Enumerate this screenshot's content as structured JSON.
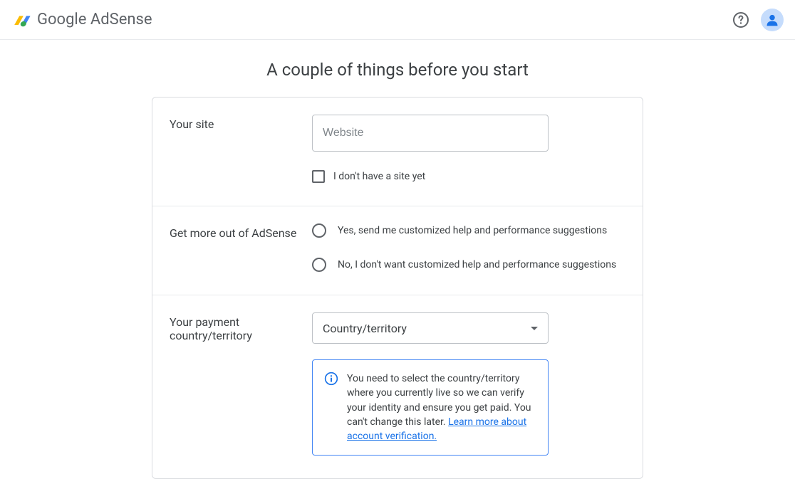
{
  "header": {
    "brand_google": "Google",
    "brand_product": "AdSense"
  },
  "page": {
    "title": "A couple of things before you start"
  },
  "site_section": {
    "label": "Your site",
    "website_placeholder": "Website",
    "no_site_label": "I don't have a site yet"
  },
  "help_section": {
    "label": "Get more out of AdSense",
    "option_yes": "Yes, send me customized help and performance suggestions",
    "option_no": "No, I don't want customized help and performance suggestions"
  },
  "country_section": {
    "label": "Your payment country/territory",
    "select_placeholder": "Country/territory",
    "info_text": "You need to select the country/territory where you currently live so we can verify your identity and ensure you get paid. You can't change this later. ",
    "info_link": "Learn more about account verification."
  }
}
